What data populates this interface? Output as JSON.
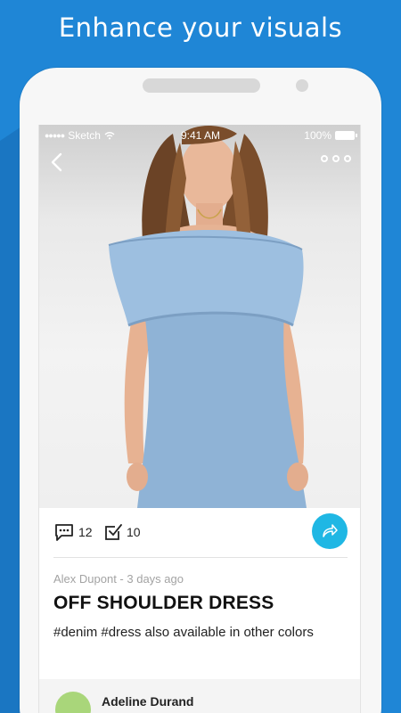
{
  "headline": "Enhance your visuals",
  "status_bar": {
    "carrier": "Sketch",
    "time": "9:41 AM",
    "battery": "100%"
  },
  "nav": {
    "back_icon": "chevron-left-icon",
    "more_icon": "more-horizontal-icon"
  },
  "post": {
    "image_alt": "Model wearing light blue off-shoulder denim dress",
    "comments_count": "12",
    "checks_count": "10",
    "author": "Alex Dupont",
    "time_ago": "3 days ago",
    "meta": "Alex Dupont - 3 days ago",
    "title": "OFF SHOULDER DRESS",
    "description": "#denim #dress also available in other colors"
  },
  "comment": {
    "name": "Adeline Durand"
  },
  "colors": {
    "background": "#1f86d6",
    "share_button": "#1fb7e4",
    "avatar": "#a9d67a"
  }
}
